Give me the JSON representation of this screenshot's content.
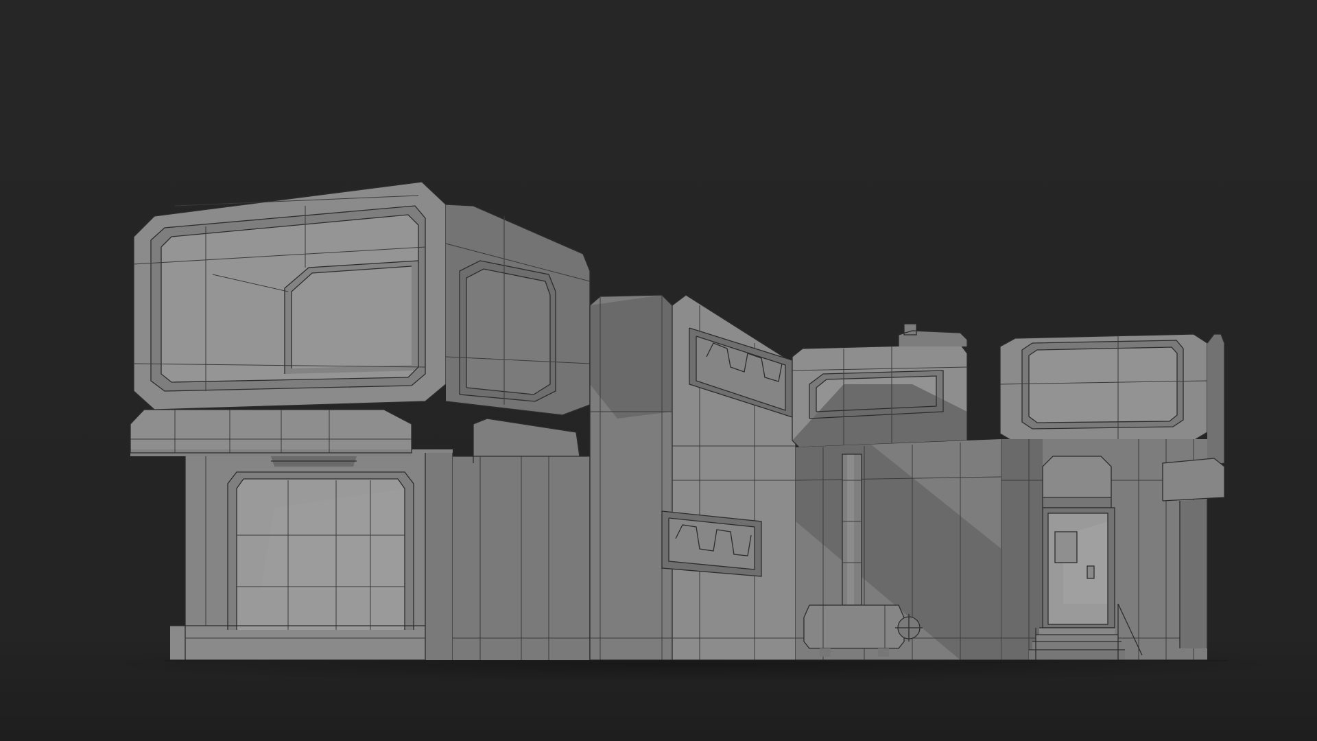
{
  "scene": {
    "subject": "sci-fi-building-model",
    "render_mode": "clay-wireframe",
    "colors": {
      "background": "#252525",
      "floor": "#1f1f1f",
      "surface_lit": "#8a8a8a",
      "surface_mid": "#7b7b7b",
      "surface_shadow": "#5e5e5e",
      "edge": "#2c2c2c"
    }
  }
}
